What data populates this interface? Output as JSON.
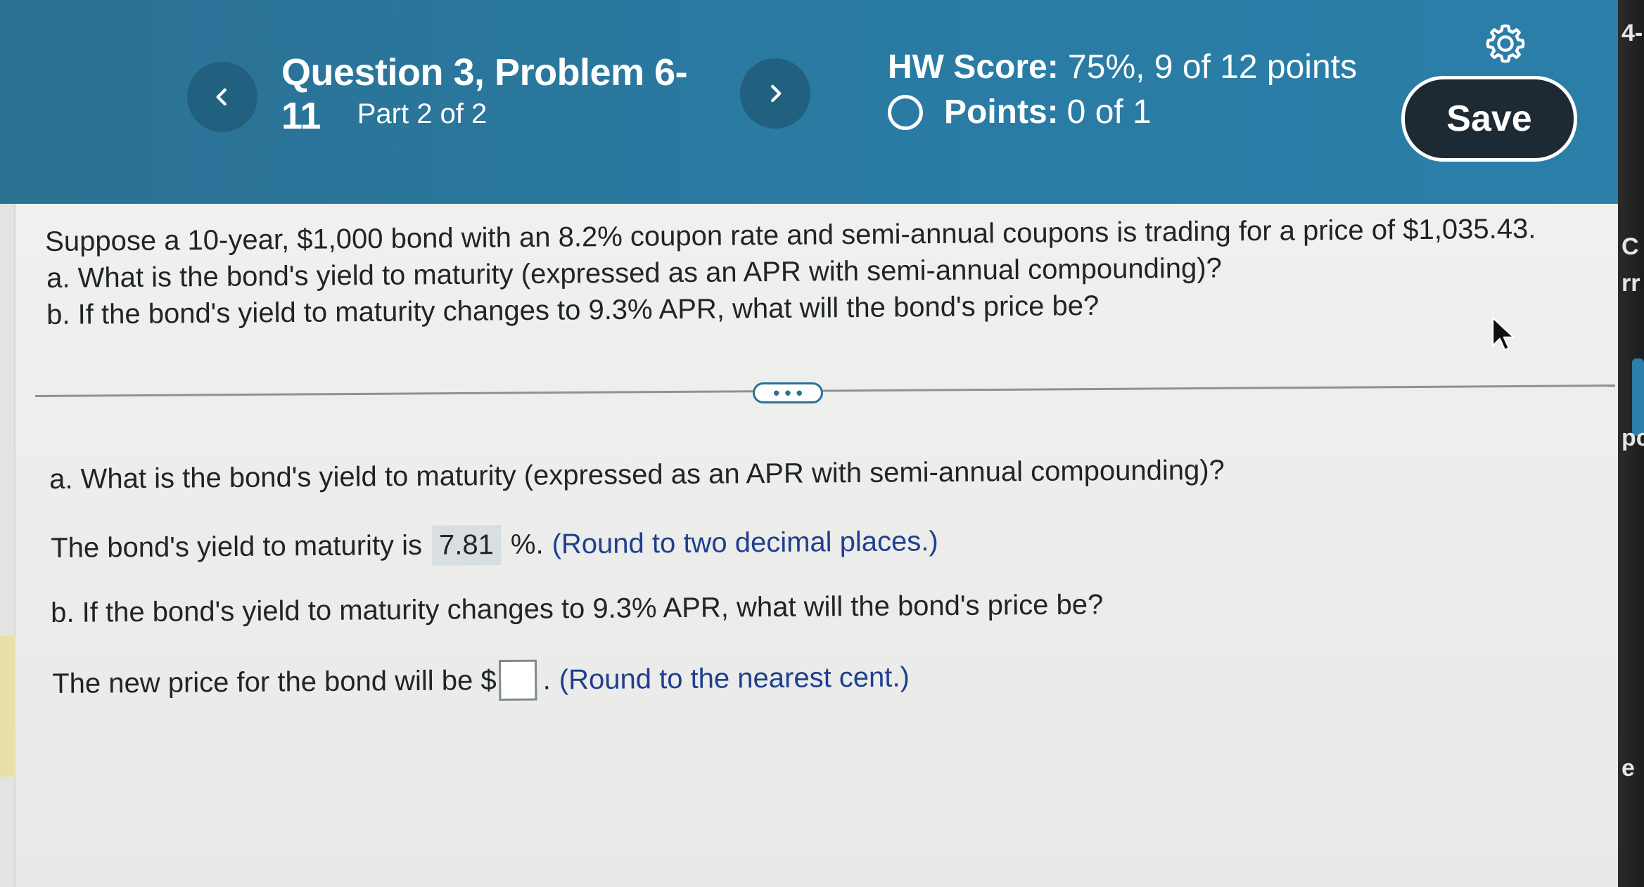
{
  "header": {
    "prev_label": "<",
    "next_label": ">",
    "question_title": "Question 3, Problem 6-11",
    "part_label": "Part 2 of 2",
    "hw_score_label": "HW Score:",
    "hw_score_value": "75%, 9 of 12 points",
    "points_label": "Points:",
    "points_value": "0 of 1",
    "save_label": "Save"
  },
  "problem": {
    "intro": "Suppose a 10-year, $1,000 bond with an 8.2% coupon rate and semi-annual coupons is trading for a price of $1,035.43.",
    "intro_a": "a. What is the bond's yield to maturity (expressed as an APR with semi-annual compounding)?",
    "intro_b": "b. If the bond's yield to maturity changes to 9.3% APR, what will the bond's price be?"
  },
  "expand_label": "• • •",
  "answers": {
    "part_a_question": "a. What is the bond's yield to maturity (expressed as an APR with semi-annual compounding)?",
    "ytm_prefix": "The bond's yield to maturity is",
    "ytm_value": "7.81",
    "ytm_suffix": "%.",
    "ytm_hint": "(Round to two decimal places.)",
    "part_b_question": "b. If the bond's yield to maturity changes to 9.3% APR, what will the bond's price be?",
    "price_prefix": "The new price for the bond will be $",
    "price_suffix": ".",
    "price_hint": "(Round to the nearest cent.)"
  },
  "right_strip": {
    "glyph_top": "4-",
    "glyph_c": "C",
    "glyph_rr": "rr",
    "glyph_pc": "pc",
    "glyph_e": "e"
  },
  "colors": {
    "header_bg": "#2a7ba3",
    "nav_button": "#22607f",
    "save_button": "#1d2a33",
    "hint_text": "#1f3f8f"
  }
}
